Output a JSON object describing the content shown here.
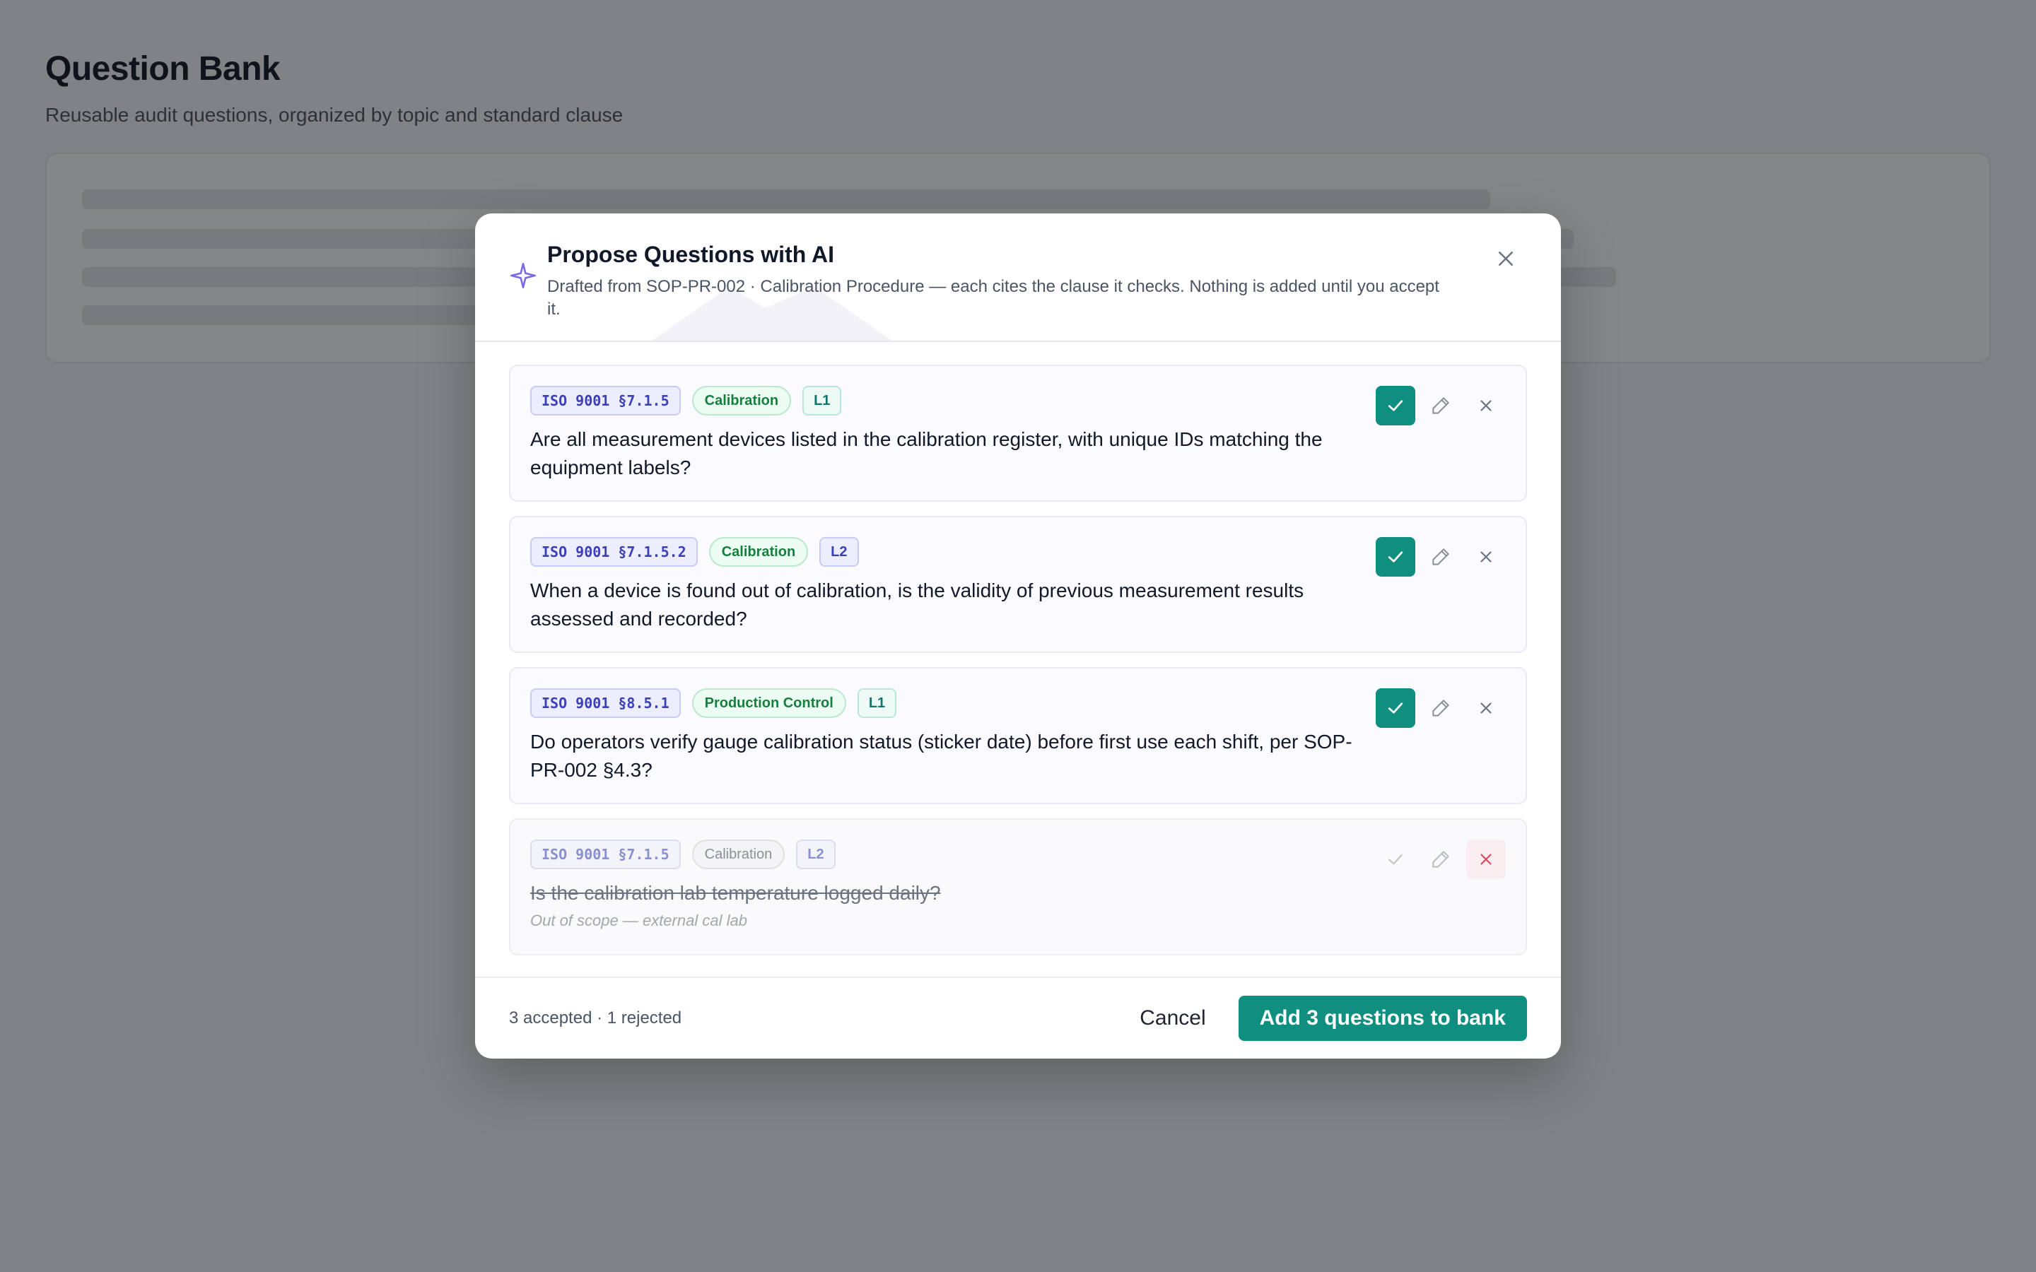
{
  "page": {
    "title": "Question Bank",
    "subtitle": "Reusable audit questions, organized by topic and standard clause"
  },
  "modal": {
    "title": "Propose Questions with AI",
    "description": "Drafted from SOP-PR-002 · Calibration Procedure — each cites the clause it checks. Nothing is added until you accept it.",
    "icons": {
      "header": "sparkle-icon",
      "close": "close-icon"
    }
  },
  "questions": [
    {
      "clause": "ISO 9001 §7.1.5",
      "topic": "Calibration",
      "level": "L1",
      "text": "Are all measurement devices listed in the calibration register, with unique IDs matching the equipment labels?",
      "status": "accepted"
    },
    {
      "clause": "ISO 9001 §7.1.5.2",
      "topic": "Calibration",
      "level": "L2",
      "text": "When a device is found out of calibration, is the validity of previous measurement results assessed and recorded?",
      "status": "accepted"
    },
    {
      "clause": "ISO 9001 §8.5.1",
      "topic": "Production Control",
      "level": "L1",
      "text": "Do operators verify gauge calibration status (sticker date) before first use each shift, per SOP-PR-002 §4.3?",
      "status": "accepted"
    },
    {
      "clause": "ISO 9001 §7.1.5",
      "topic": "Calibration",
      "level": "L2",
      "text": "Is the calibration lab temperature logged daily?",
      "status": "rejected",
      "note": "Out of scope — external cal lab"
    }
  ],
  "footer": {
    "status": "3 accepted · 1 rejected",
    "cancel_label": "Cancel",
    "submit_label": "Add 3 questions to bank"
  },
  "colors": {
    "accent": "#0f8f80",
    "sparkle": "#7c6ae6",
    "reject": "#e0465f",
    "clause_text": "#3b3fb8"
  }
}
